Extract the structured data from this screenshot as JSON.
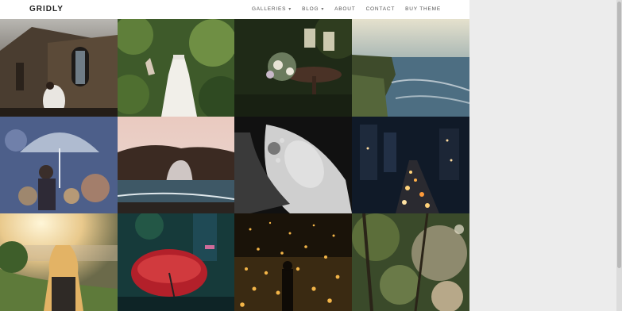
{
  "header": {
    "logo": "GRIDLY",
    "nav": [
      {
        "label": "GALLERIES",
        "has_dropdown": true
      },
      {
        "label": "BLOG",
        "has_dropdown": true
      },
      {
        "label": "ABOUT",
        "has_dropdown": false
      },
      {
        "label": "CONTACT",
        "has_dropdown": false
      },
      {
        "label": "BUY THEME",
        "has_dropdown": false
      }
    ]
  },
  "gallery": {
    "tiles": [
      {
        "subject": "wedding-couple-architecture"
      },
      {
        "subject": "wedding-dress-hanging"
      },
      {
        "subject": "bouquet-and-glasses"
      },
      {
        "subject": "coastal-cliffs"
      },
      {
        "subject": "clear-umbrella-bokeh"
      },
      {
        "subject": "sea-arch-rock"
      },
      {
        "subject": "woman-bw-portrait"
      },
      {
        "subject": "city-night-traffic"
      },
      {
        "subject": "girl-sunset-field"
      },
      {
        "subject": "red-umbrella-night"
      },
      {
        "subject": "floating-lanterns"
      },
      {
        "subject": "forest-bokeh"
      }
    ]
  },
  "colors": {
    "header_bg": "#ffffff",
    "page_bg": "#ececec"
  }
}
